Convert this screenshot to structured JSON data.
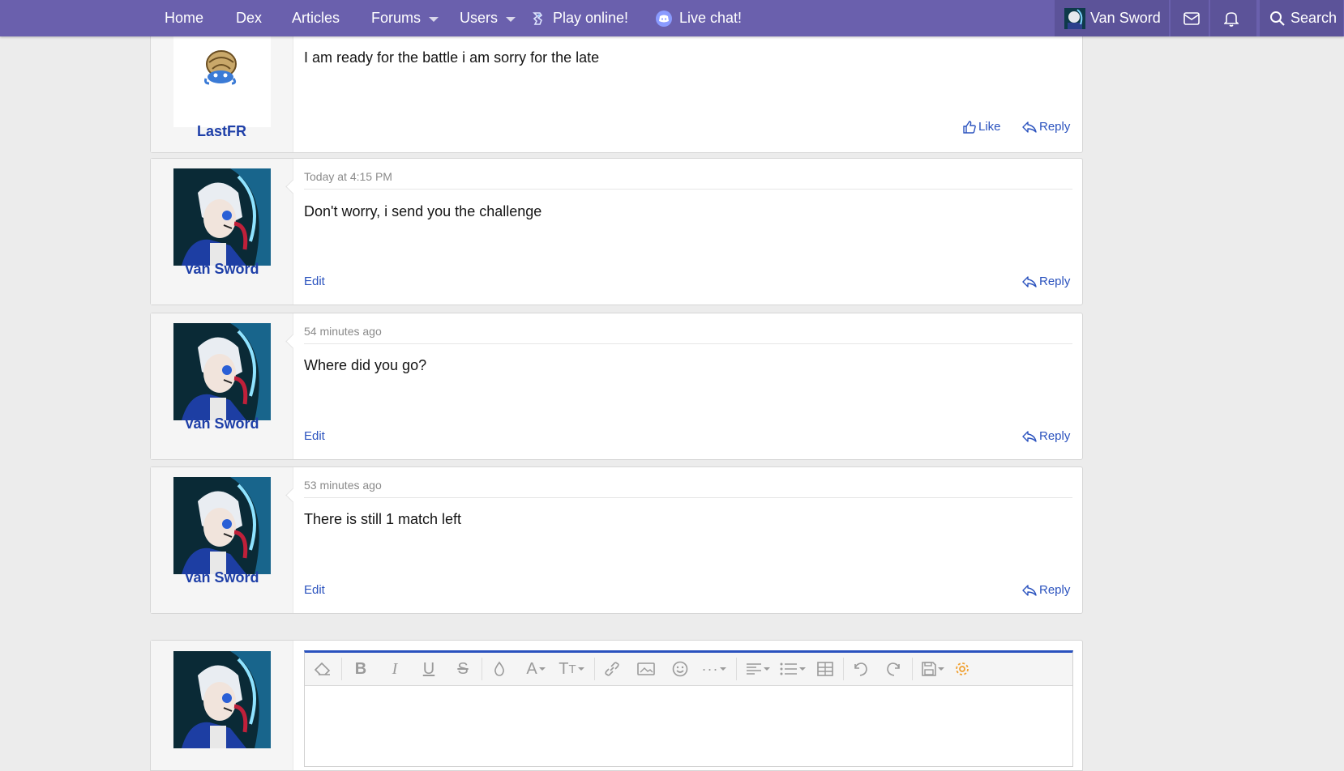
{
  "nav": {
    "home": "Home",
    "dex": "Dex",
    "articles": "Articles",
    "forums": "Forums",
    "users": "Users",
    "play": "Play online!",
    "chat": "Live chat!",
    "account": "Van Sword",
    "search": "Search"
  },
  "posts": [
    {
      "user": "LastFR",
      "time": "",
      "message": "I am ready for the battle i am sorry for the late",
      "left_action": "",
      "like": "Like",
      "reply": "Reply"
    },
    {
      "user": "Van Sword",
      "time": "Today at 4:15 PM",
      "message": "Don't worry, i send you the challenge",
      "left_action": "Edit",
      "reply": "Reply"
    },
    {
      "user": "Van Sword",
      "time": "54 minutes ago",
      "message": "Where did you go?",
      "left_action": "Edit",
      "reply": "Reply"
    },
    {
      "user": "Van Sword",
      "time": "53 minutes ago",
      "message": "There is still 1 match left",
      "left_action": "Edit",
      "reply": "Reply"
    }
  ],
  "editor": {
    "toolbar": [
      "eraser-icon",
      "bold-icon",
      "italic-icon",
      "underline-icon",
      "strike-icon",
      "color-icon",
      "font-icon",
      "size-icon",
      "link-icon",
      "image-icon",
      "smile-icon",
      "more-icon",
      "align-icon",
      "list-icon",
      "table-icon",
      "undo-icon",
      "redo-icon",
      "save-icon",
      "gear-icon"
    ]
  },
  "colors": {
    "nav": "#6a60ad",
    "link": "#2a52be",
    "username": "#1e3fa8",
    "gear": "#f0a030"
  }
}
